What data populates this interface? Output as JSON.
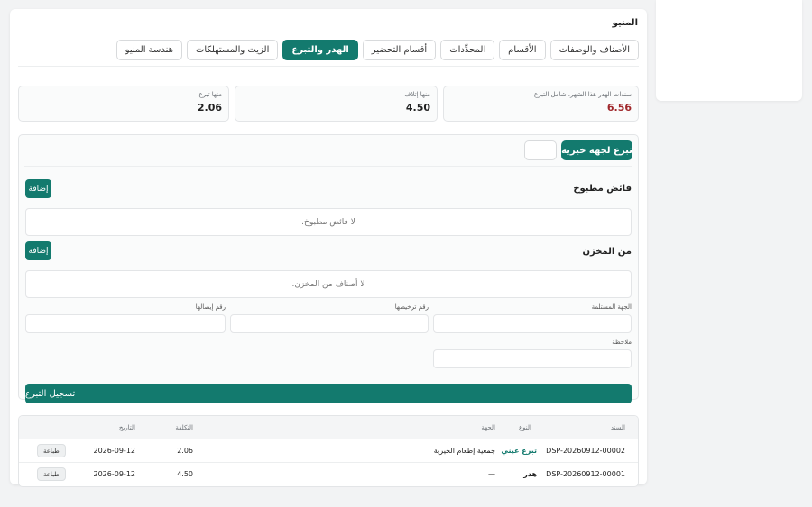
{
  "card": {
    "title": "المنيو"
  },
  "tabs": [
    {
      "label": "الأصناف والوصفات",
      "active": false
    },
    {
      "label": "الأقسام",
      "active": false
    },
    {
      "label": "المحدِّدات",
      "active": false
    },
    {
      "label": "أقسام التحضير",
      "active": false
    },
    {
      "label": "الهدر والتبرع",
      "active": true
    },
    {
      "label": "الزيت والمستهلكات",
      "active": false
    },
    {
      "label": "هندسة المنيو",
      "active": false
    }
  ],
  "stats": [
    {
      "label": "سندات الهدر هذا الشهر، شامل التبرع",
      "value": "6.56",
      "color": "#a0282c"
    },
    {
      "label": "منها إتلاف",
      "value": "4.50"
    },
    {
      "label": "منها تبرع",
      "value": "2.06"
    }
  ],
  "donate": {
    "button_label": "تبرع لجهة خيرية"
  },
  "cooked_surplus": {
    "title": "فائض مطبوخ",
    "add_label": "إضافة",
    "empty_text": "لا فائض مطبوخ."
  },
  "from_store": {
    "title": "من المخزن",
    "add_label": "إضافة",
    "empty_text": "لا أصناف من المخزن."
  },
  "form": {
    "recipient_label": "الجهة المستلمة",
    "license_label": "رقم ترخيصها",
    "receipt_label": "رقم إيصالها",
    "note_label": "ملاحظة",
    "submit_label": "تسجيل التبرع"
  },
  "table": {
    "headers": {
      "doc": "السند",
      "type": "النوع",
      "entity": "الجهة",
      "cost": "التكلفة",
      "date": "التاريخ"
    },
    "rows": [
      {
        "doc": "DSP-20260912-00002",
        "type": "تبرع عيني",
        "type_style": "green",
        "entity": "جمعية إطعام الخيرية",
        "cost": "2.06",
        "date": "2026-09-12",
        "action": "طباعة"
      },
      {
        "doc": "DSP-20260912-00001",
        "type": "هدر",
        "type_style": "dark",
        "entity": "—",
        "cost": "4.50",
        "date": "2026-09-12",
        "action": "طباعة"
      }
    ]
  },
  "colors": {
    "accent": "#137a6e",
    "danger": "#a0282c",
    "background": "#f2f3f4"
  }
}
